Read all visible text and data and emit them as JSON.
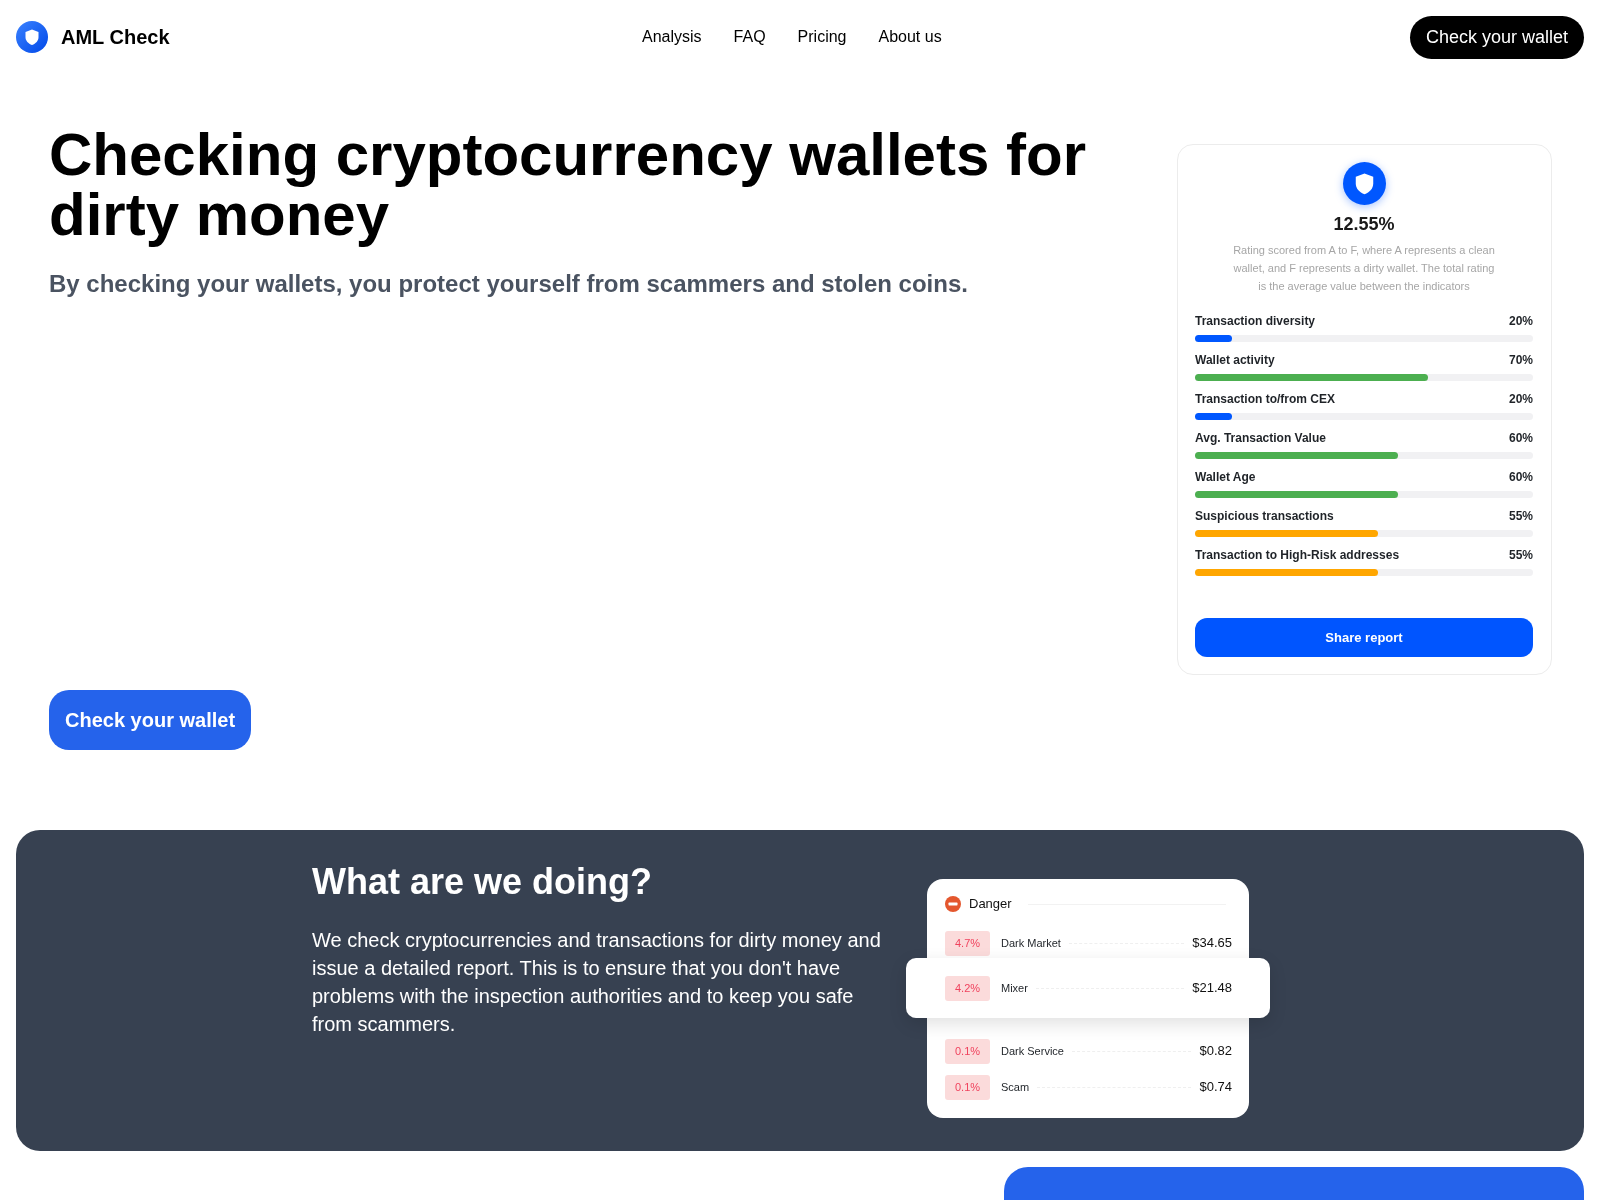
{
  "header": {
    "brand": "AML Check",
    "nav": [
      "Analysis",
      "FAQ",
      "Pricing",
      "About us"
    ],
    "cta": "Check your wallet"
  },
  "hero": {
    "title": "Checking cryptocurrency wallets for dirty money",
    "subtitle": "By checking your wallets, you protect yourself from scammers and stolen coins.",
    "cta": "Check your wallet"
  },
  "rating_card": {
    "score": "12.55%",
    "description": "Rating scored from A to F, where A represents a clean wallet, and F represents a dirty wallet. The total rating is the average value between the indicators",
    "indicators": [
      {
        "name": "Transaction diversity",
        "reading": "20%",
        "level": 0.11,
        "color": "#0057ff"
      },
      {
        "name": "Wallet activity",
        "reading": "70%",
        "level": 0.69,
        "color": "#4caf50"
      },
      {
        "name": "Transaction to/from CEX",
        "reading": "20%",
        "level": 0.11,
        "color": "#0057ff"
      },
      {
        "name": "Avg. Transaction Value",
        "reading": "60%",
        "level": 0.6,
        "color": "#4caf50"
      },
      {
        "name": "Wallet Age",
        "reading": "60%",
        "level": 0.6,
        "color": "#4caf50"
      },
      {
        "name": "Suspicious transactions",
        "reading": "55%",
        "level": 0.54,
        "color": "#ffa600"
      },
      {
        "name": "Transaction to High-Risk addresses",
        "reading": "55%",
        "level": 0.54,
        "color": "#ffa600"
      }
    ],
    "button": "Share report"
  },
  "about": {
    "heading": "What are we doing?",
    "text": "We check cryptocurrencies and transactions for dirty money and issue a detailed report. This is to ensure that you don't have problems with the inspection authorities and to keep you safe from scammers.",
    "danger_card": {
      "title": "Danger",
      "rows": [
        {
          "share": "4.7%",
          "name": "Dark Market",
          "amount": "$34.65",
          "highlighted": false
        },
        {
          "share": "4.2%",
          "name": "Mixer",
          "amount": "$21.48",
          "highlighted": true
        },
        {
          "share": "0.1%",
          "name": "Dark Service",
          "amount": "$0.82",
          "highlighted": false
        },
        {
          "share": "0.1%",
          "name": "Scam",
          "amount": "$0.74",
          "highlighted": false
        }
      ]
    }
  }
}
